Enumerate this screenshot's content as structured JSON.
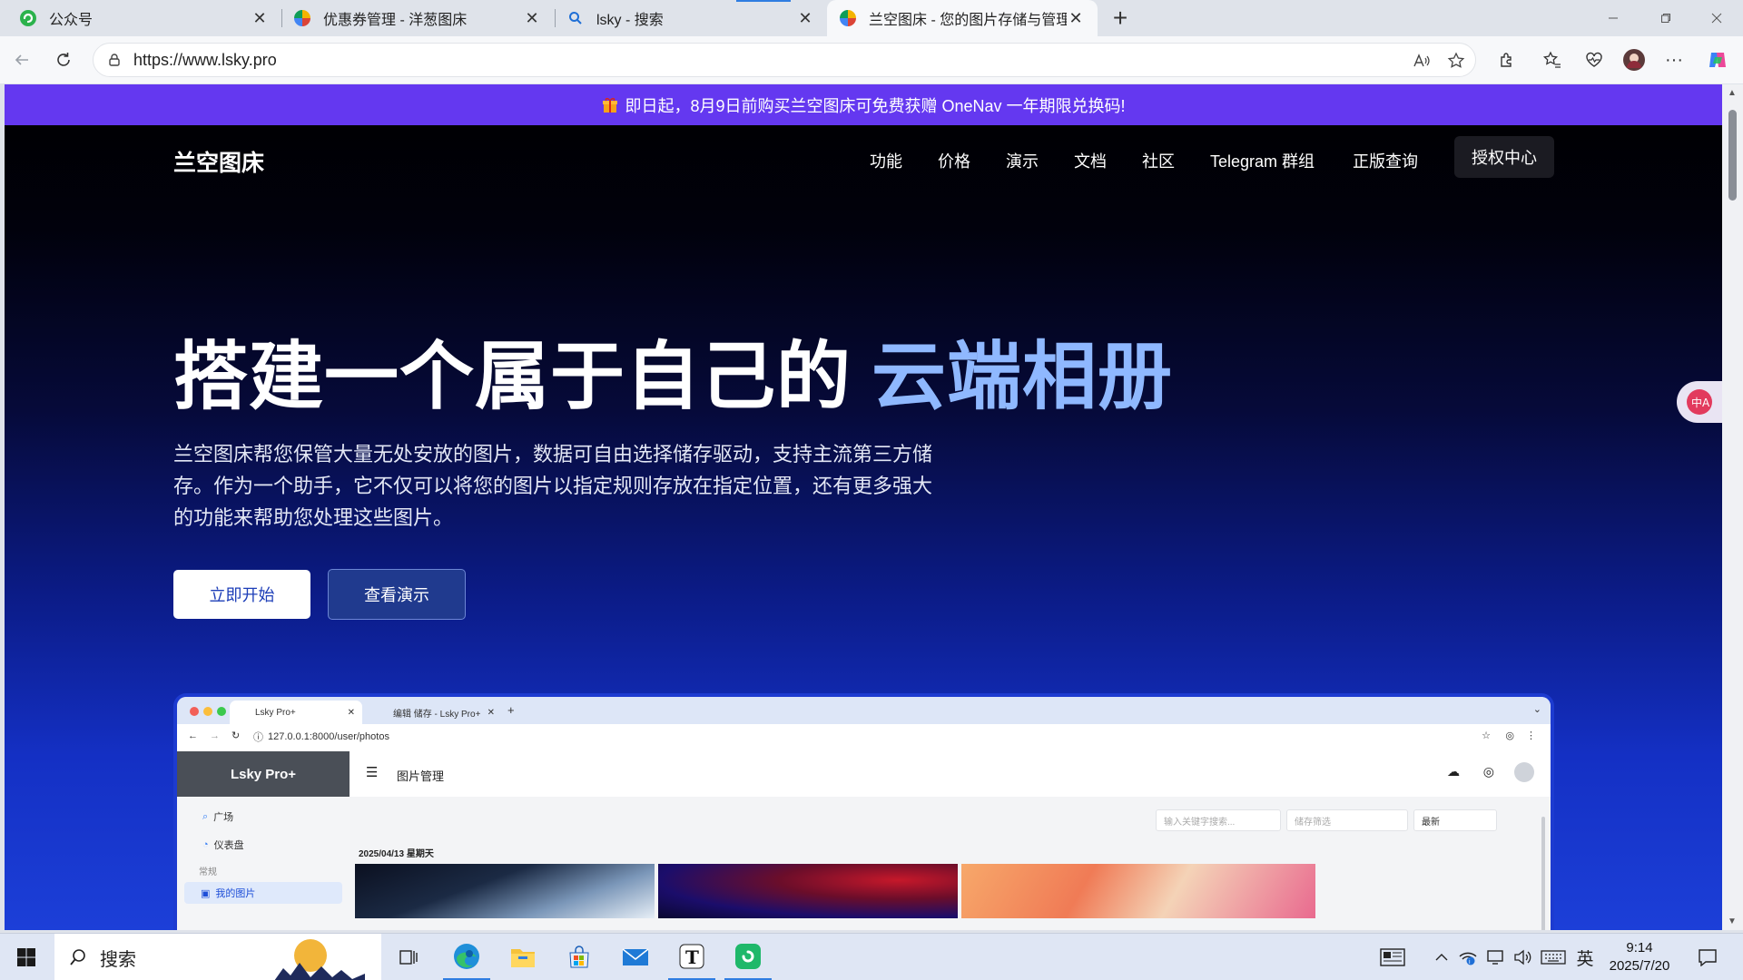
{
  "browser": {
    "tabs": [
      {
        "title": "公众号",
        "active": false
      },
      {
        "title": "优惠券管理 - 洋葱图床",
        "active": false
      },
      {
        "title": "lsky - 搜索",
        "active": false
      },
      {
        "title": "兰空图床 - 您的图片存储与管理解",
        "active": true
      }
    ],
    "new_tab": "+",
    "url": "https://www.lsky.pro"
  },
  "promo": {
    "text": "即日起，8月9日前购买兰空图床可免费获赠 OneNav 一年期限兑换码!"
  },
  "site": {
    "brand": "兰空图床",
    "nav": [
      "功能",
      "价格",
      "演示",
      "文档",
      "社区",
      "Telegram 群组",
      "正版查询"
    ],
    "nav_cta": "授权中心"
  },
  "hero": {
    "title": "搭建一个属于自己的",
    "title_accent": "云端相册",
    "description": "兰空图床帮您保管大量无处安放的图片，数据可自由选择储存驱动，支持主流第三方储存。作为一个助手，它不仅可以将您的图片以指定规则存放在指定位置，还有更多强大的功能来帮助您处理这些图片。",
    "primary_button": "立即开始",
    "secondary_button": "查看演示"
  },
  "mockup": {
    "tabs": [
      "Lsky Pro+",
      "编辑 储存 - Lsky Pro+"
    ],
    "url": "127.0.0.1:8000/user/photos",
    "brand": "Lsky Pro+",
    "menu": [
      "广场",
      "仪表盘"
    ],
    "section": "常规",
    "active_item": "我的图片",
    "page_title": "图片管理",
    "search_placeholder": "输入关键字搜索...",
    "storage_placeholder": "储存筛选",
    "sort": "最新",
    "date": "2025/04/13 星期天"
  },
  "taskbar": {
    "search_label": "搜索",
    "ime": "英",
    "time": "9:14",
    "date": "2025/7/20"
  },
  "colors": {
    "promo": "#6438f0",
    "accent": "#8fb8ff",
    "primary_text": "#1d3eb8"
  }
}
